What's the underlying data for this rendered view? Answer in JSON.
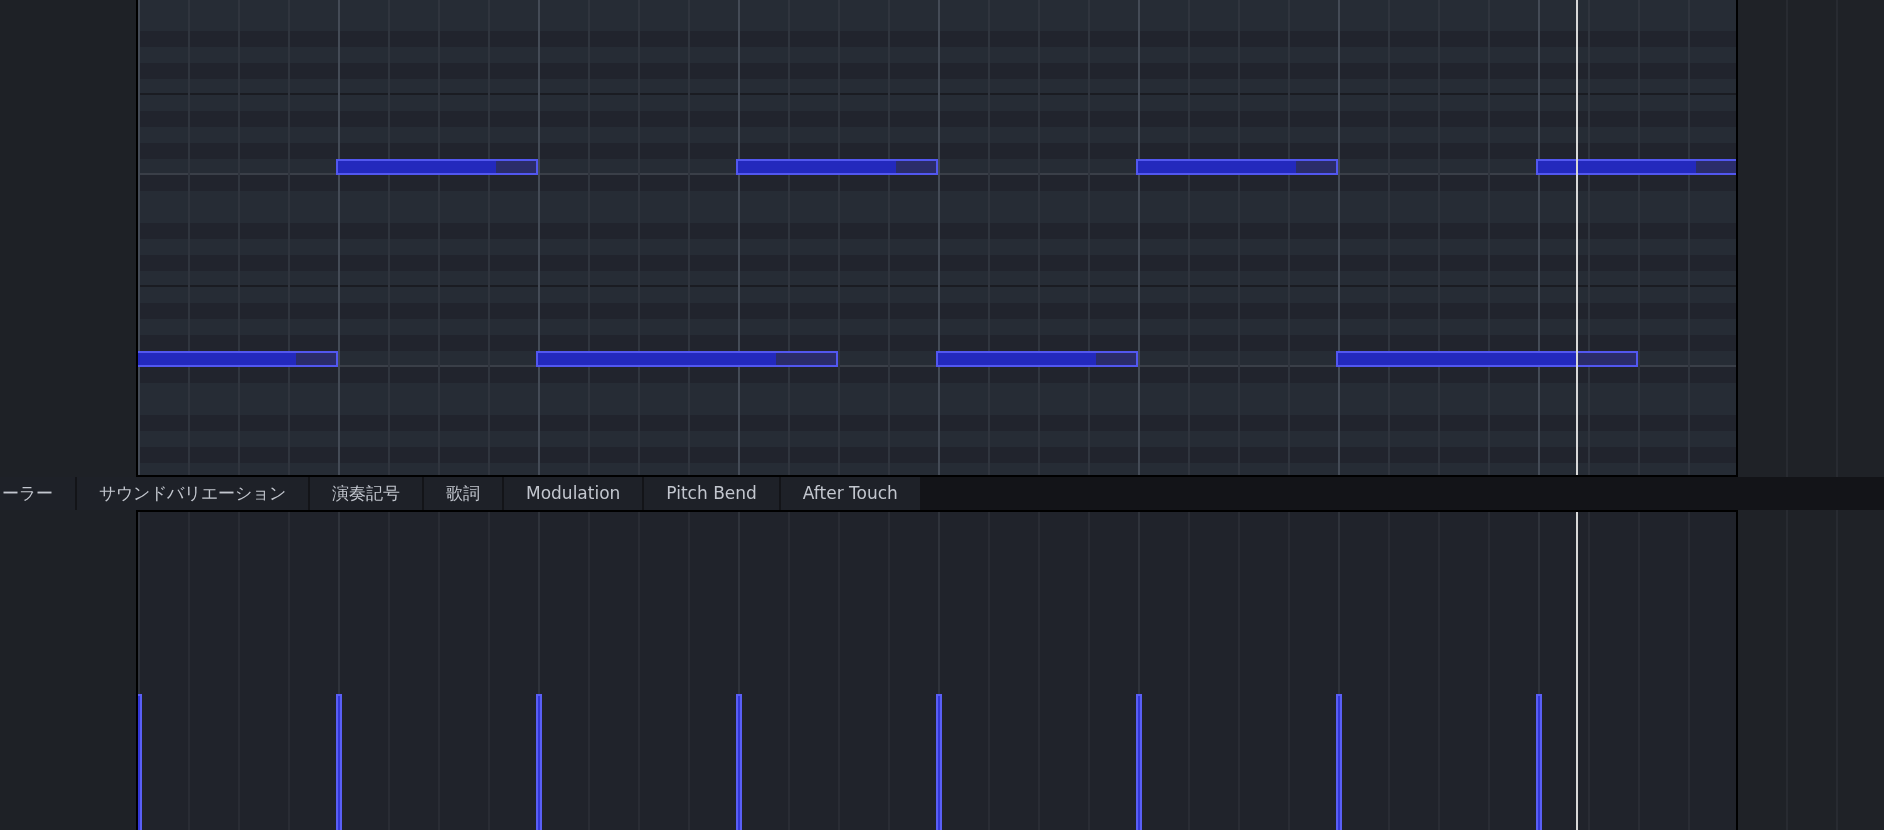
{
  "piano_roll": {
    "playhead": {
      "level": 0.9
    },
    "notes": [
      {
        "kind": "low",
        "long": false,
        "level": 0.8
      },
      {
        "kind": "high",
        "long": false,
        "level": 0.8
      },
      {
        "kind": "low",
        "long": true,
        "level": 0.8
      },
      {
        "kind": "high",
        "long": false,
        "level": 0.8
      },
      {
        "kind": "low",
        "long": false,
        "level": 0.8
      },
      {
        "kind": "high",
        "long": false,
        "level": 0.8
      },
      {
        "kind": "low",
        "long": true,
        "level": 0.8
      },
      {
        "kind": "high",
        "long": false,
        "level": 0.8
      }
    ]
  },
  "tabs": [
    {
      "label": "ーラー"
    },
    {
      "label": "サウンドバリエーション"
    },
    {
      "label": "演奏記号"
    },
    {
      "label": "歌詞"
    },
    {
      "label": "Modulation"
    },
    {
      "label": "Pitch Bend"
    },
    {
      "label": "After Touch"
    }
  ]
}
